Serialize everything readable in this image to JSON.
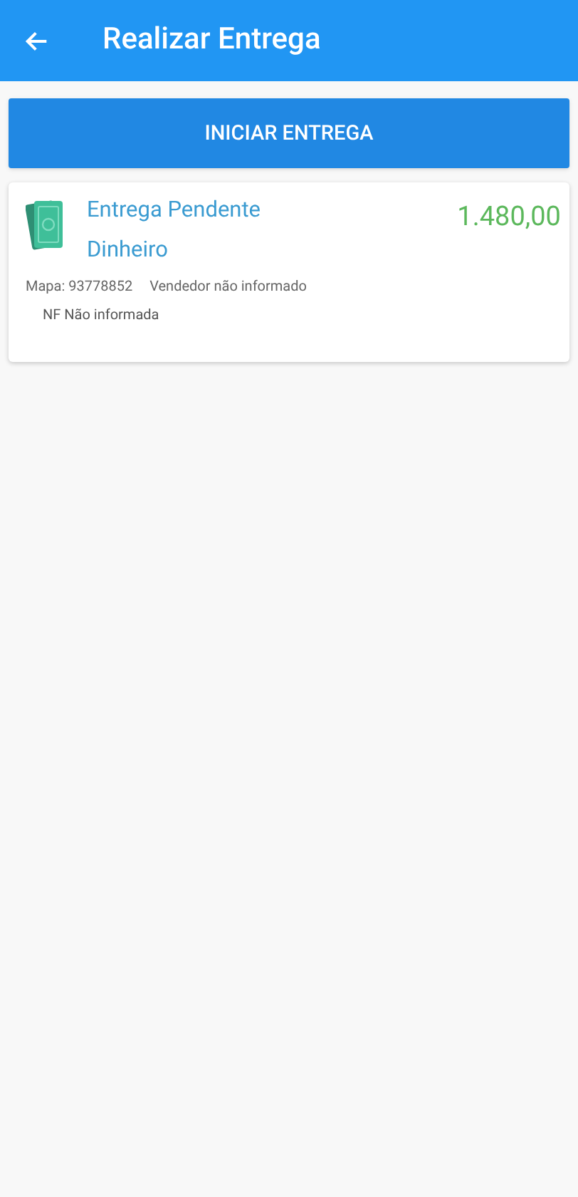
{
  "app_bar": {
    "title": "Realizar Entrega"
  },
  "start_button": {
    "label": "INICIAR ENTREGA"
  },
  "deliveries": [
    {
      "status": "Entrega Pendente",
      "payment": "Dinheiro",
      "amount": "1.480,00",
      "map": "Mapa: 93778852",
      "seller": "Vendedor não informado",
      "invoice": "NF Não informada"
    }
  ]
}
